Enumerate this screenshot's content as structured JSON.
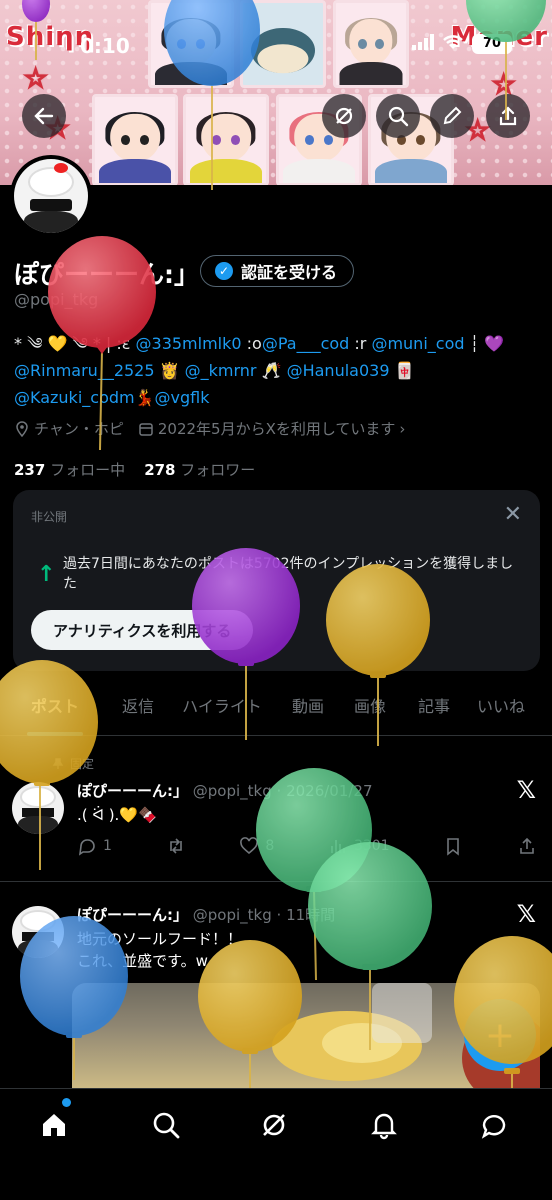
{
  "status_bar": {
    "time": "0:10",
    "battery": "70"
  },
  "banner": {
    "left_word": "Shiηη",
    "right_word": "Mener"
  },
  "profile": {
    "display_name": "ぽぴーーーん:」",
    "handle": "@popi_tkg",
    "verify_label": "認証を受ける",
    "bio_line1_prefix": "* ༄ 💛 ༄ * | :ε ",
    "bio_mention1": "@335mlmlk0",
    "bio_mid1": " :o",
    "bio_mention2": "@Pa___cod",
    "bio_mid2": " :r ",
    "bio_mention3": "@muni_cod",
    "bio_tail1": " ┆ 💜",
    "bio_mention4": "@Rinmaru__2525",
    "bio_mid4": " 👸 ",
    "bio_mention5": "@_kmrnr",
    "bio_mid5": " 🥂 ",
    "bio_mention6": "@Hanula039",
    "bio_mid6": " 🀄",
    "bio_mention7": "@Kazuki_codm",
    "bio_mid7": "💃",
    "bio_mention8": "@vgflk",
    "location": "チャン・ホピ",
    "joined": "2022年5月からXを利用しています",
    "following_count": "237",
    "following_label": "フォロー中",
    "followers_count": "278",
    "followers_label": "フォロワー"
  },
  "analytics_card": {
    "tag": "非公開",
    "text": "過去7日間にあなたのポストは5702件のインプレッションを獲得しました",
    "button": "アナリティクスを利用する"
  },
  "tabs": [
    "ポスト",
    "返信",
    "ハイライト",
    "動画",
    "画像",
    "記事",
    "いいね"
  ],
  "posts": [
    {
      "pinned_label": "固定",
      "name": "ぽぴーーーん:」",
      "handle_time": "@popi_tkg · 2026/01/27",
      "text": ".( ᐛ ).💛🍫",
      "replies": "1",
      "likes": "8",
      "views": "3301"
    },
    {
      "name": "ぽぴーーーん:」",
      "handle_time": "@popi_tkg · 11時間",
      "text_line1": "地元のソールフード！！",
      "text_line2": "これ、並盛です。w"
    }
  ],
  "colors": {
    "accent": "#1d9bf0",
    "green": "#00ba7c",
    "balloon_red": "#e23d4e",
    "balloon_purple": "#9b2fd1",
    "balloon_yellow": "#e3b52b",
    "balloon_green": "#5fcf8e",
    "balloon_blue": "#3d8fe0"
  },
  "icons": [
    "back-arrow-icon",
    "grok-icon",
    "search-icon",
    "edit-pencil-icon",
    "share-icon",
    "verified-icon",
    "location-icon",
    "calendar-icon",
    "close-icon",
    "trend-up-icon",
    "pin-icon",
    "x-logo-icon",
    "reply-icon",
    "repost-icon",
    "like-icon",
    "views-icon",
    "bookmark-icon",
    "home-icon",
    "bell-icon",
    "chat-icon",
    "plus-icon"
  ]
}
